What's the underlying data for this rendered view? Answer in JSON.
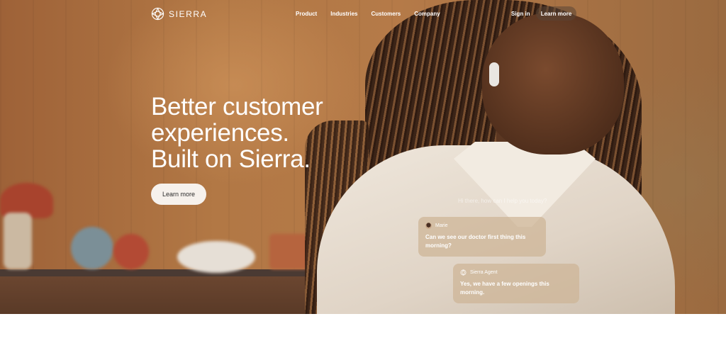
{
  "brand": {
    "name": "SIERRA",
    "logo_icon": "sierra-logo-icon"
  },
  "nav": {
    "links": [
      "Product",
      "Industries",
      "Customers",
      "Company"
    ],
    "sign_in": "Sign in",
    "cta": "Learn more"
  },
  "hero": {
    "headline_lines": [
      "Better customer",
      "experiences.",
      "Built on Sierra."
    ],
    "cta": "Learn more"
  },
  "chat": {
    "prompt": "Hi there, how can I help you today?",
    "messages": [
      {
        "sender": "Marie",
        "text": "Can we see our doctor first thing this morning?",
        "icon": "avatar"
      },
      {
        "sender": "Sierra Agent",
        "text": "Yes, we have a few openings this morning.",
        "icon": "sierra-agent-icon"
      }
    ]
  },
  "colors": {
    "hero_bg": "#b27845",
    "cta_bg": "#f6f1ec",
    "nav_cta_bg": "#5a4637"
  }
}
